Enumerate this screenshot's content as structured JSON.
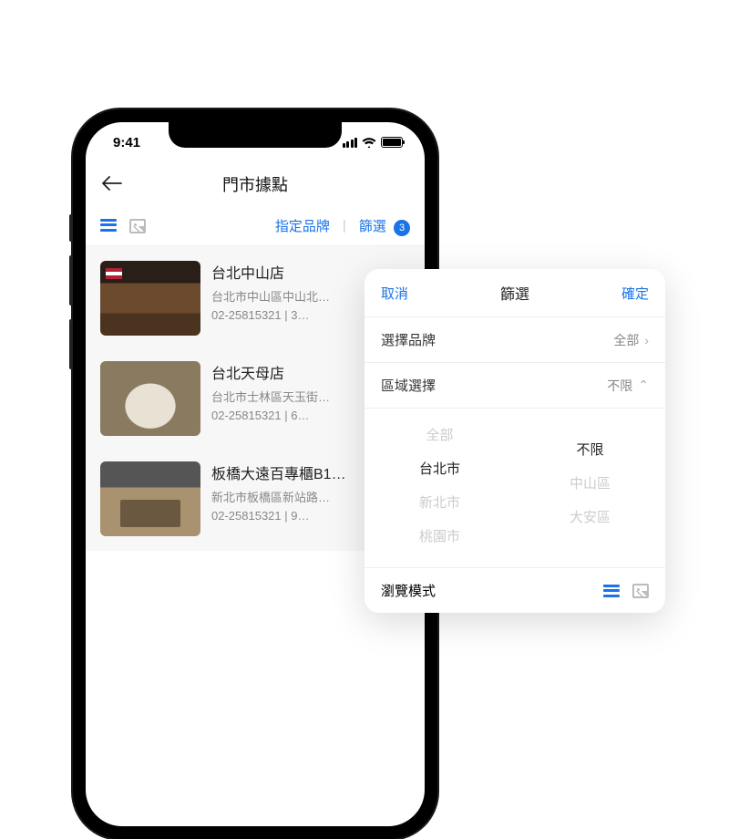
{
  "status": {
    "time": "9:41"
  },
  "nav": {
    "title": "門市據點"
  },
  "toolbar": {
    "brand_label": "指定品牌",
    "filter_label": "篩選",
    "filter_count": "3"
  },
  "stores": [
    {
      "name": "台北中山店",
      "address": "台北市中山區中山北…",
      "phone": "02-25815321  |  3…"
    },
    {
      "name": "台北天母店",
      "address": "台北市士林區天玉街…",
      "phone": "02-25815321  |  6…"
    },
    {
      "name": "板橋大遠百專櫃B1…",
      "address": "新北市板橋區新站路…",
      "phone": "02-25815321  |  9…"
    }
  ],
  "panel": {
    "cancel": "取消",
    "title": "篩選",
    "confirm": "確定",
    "brand": {
      "label": "選擇品牌",
      "value": "全部"
    },
    "area": {
      "label": "區域選擇",
      "value": "不限"
    },
    "picker": {
      "left": [
        "全部",
        "台北市",
        "新北市",
        "桃園市"
      ],
      "right": [
        "",
        "不限",
        "中山區",
        "大安區"
      ]
    },
    "browse_label": "瀏覽模式"
  }
}
